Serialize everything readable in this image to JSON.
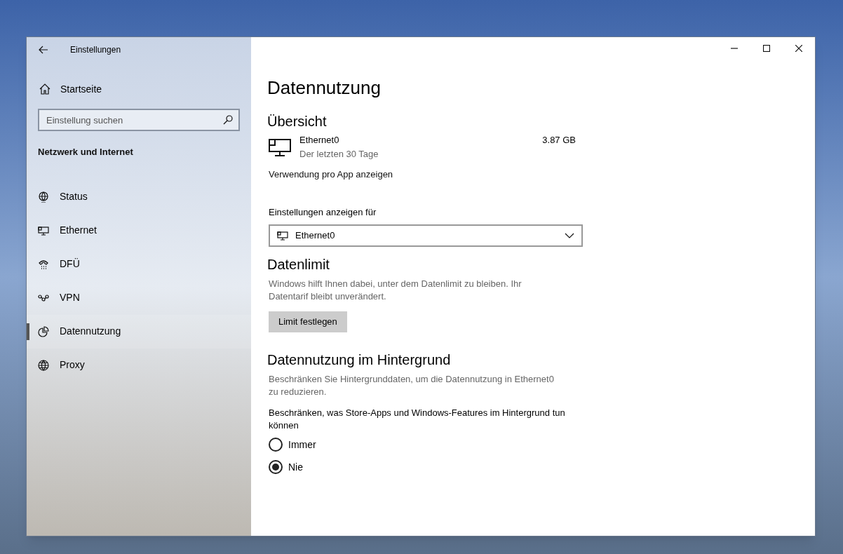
{
  "window": {
    "title": "Einstellungen"
  },
  "sidebar": {
    "home": "Startseite",
    "search": {
      "placeholder": "Einstellung suchen"
    },
    "section": "Netzwerk und Internet",
    "items": [
      {
        "label": "Status",
        "kind": "status",
        "selected": false
      },
      {
        "label": "Ethernet",
        "kind": "ethernet",
        "selected": false
      },
      {
        "label": "DFÜ",
        "kind": "dialup",
        "selected": false
      },
      {
        "label": "VPN",
        "kind": "vpn",
        "selected": false
      },
      {
        "label": "Datennutzung",
        "kind": "usage",
        "selected": true
      },
      {
        "label": "Proxy",
        "kind": "proxy",
        "selected": false
      }
    ]
  },
  "page": {
    "title": "Datennutzung",
    "overview": {
      "heading": "Übersicht",
      "adapter": "Ethernet0",
      "period": "Der letzten 30 Tage",
      "amount": "3.87 GB",
      "link": "Verwendung pro App anzeigen"
    },
    "settings_for": {
      "label": "Einstellungen anzeigen für",
      "value": "Ethernet0"
    },
    "data_limit": {
      "heading": "Datenlimit",
      "description": "Windows hilft Ihnen dabei, unter dem Datenlimit zu bleiben. Ihr Datentarif bleibt unverändert.",
      "button": "Limit festlegen"
    },
    "background": {
      "heading": "Datennutzung im Hintergrund",
      "description": "Beschränken Sie Hintergrunddaten, um die Datennutzung in Ethernet0\n zu reduzieren.",
      "question": "Beschränken, was Store-Apps und Windows-Features im Hintergrund tun können",
      "options": [
        {
          "label": "Immer",
          "selected": false
        },
        {
          "label": "Nie",
          "selected": true
        }
      ]
    }
  }
}
